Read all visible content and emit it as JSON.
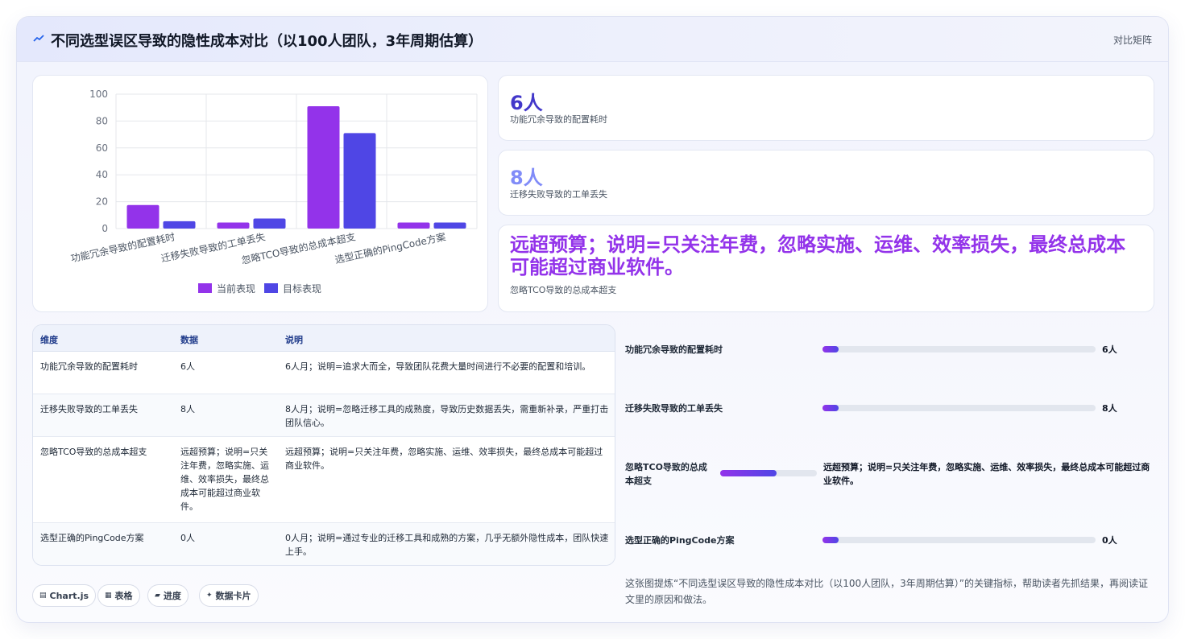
{
  "header": {
    "title": "不同选型误区导致的隐性成本对比（以100人团队，3年周期估算）",
    "right_link": "对比矩阵",
    "icon": "line-chart-icon"
  },
  "chart_data": {
    "type": "bar",
    "categories": [
      "功能冗余导致的配置耗时",
      "迁移失败导致的工单丢失",
      "忽略TCO导致的总成本超支",
      "选型正确的PingCode方案"
    ],
    "series": [
      {
        "name": "当前表现",
        "values": [
          17.5,
          4.5,
          91,
          4.5
        ],
        "color": "#9333ea"
      },
      {
        "name": "目标表现",
        "values": [
          5.5,
          7.5,
          71,
          4.5
        ],
        "color": "#4f46e5"
      }
    ],
    "yticks": [
      0,
      20,
      40,
      60,
      80,
      100
    ],
    "ylim": [
      0,
      100
    ],
    "legend_position": "bottom",
    "grid": true
  },
  "kpis": [
    {
      "value": "6人",
      "label": "功能冗余导致的配置耗时"
    },
    {
      "value": "8人",
      "label": "迁移失败导致的工单丢失"
    },
    {
      "value": "远超预算；说明=只关注年费，忽略实施、运维、效率损失，最终总成本可能超过商业软件。",
      "label": "忽略TCO导致的总成本超支"
    }
  ],
  "table": {
    "headers": [
      "维度",
      "数据",
      "说明"
    ],
    "rows": [
      {
        "dim": "功能冗余导致的配置耗时",
        "data": "6人",
        "desc": "6人月；说明=追求大而全，导致团队花费大量时间进行不必要的配置和培训。"
      },
      {
        "dim": "迁移失败导致的工单丢失",
        "data": "8人",
        "desc": "8人月；说明=忽略迁移工具的成熟度，导致历史数据丢失，需重新补录，严重打击团队信心。"
      },
      {
        "dim": "忽略TCO导致的总成本超支",
        "data": "远超预算；说明=只关注年费，忽略实施、运维、效率损失，最终总成本可能超过商业软件。",
        "desc": "远超预算；说明=只关注年费，忽略实施、运维、效率损失，最终总成本可能超过商业软件。"
      },
      {
        "dim": "选型正确的PingCode方案",
        "data": "0人",
        "desc": "0人月；说明=通过专业的迁移工具和成熟的方案，几乎无额外隐性成本，团队快速上手。"
      }
    ]
  },
  "progress": [
    {
      "label": "功能冗余导致的配置耗时",
      "value": "6人",
      "fill": 0.06
    },
    {
      "label": "迁移失败导致的工单丢失",
      "value": "8人",
      "fill": 0.06
    },
    {
      "label": "忽略TCO导致的总成本超支",
      "value": "远超预算；说明=只关注年费，忽略实施、运维、效率损失，最终总成本可能超过商业软件。",
      "fill": 0.58
    },
    {
      "label": "选型正确的PingCode方案",
      "value": "0人",
      "fill": 0.06
    }
  ],
  "note": "这张图提炼“不同选型误区导致的隐性成本对比（以100人团队，3年周期估算）”的关键指标，帮助读者先抓结果，再阅读证文里的原因和做法。",
  "chips": [
    {
      "icon": "▤",
      "label": "Chart.js"
    },
    {
      "icon": "▦",
      "label": "表格"
    },
    {
      "icon": "▰",
      "label": "进度"
    },
    {
      "icon": "✦",
      "label": "数据卡片"
    }
  ]
}
